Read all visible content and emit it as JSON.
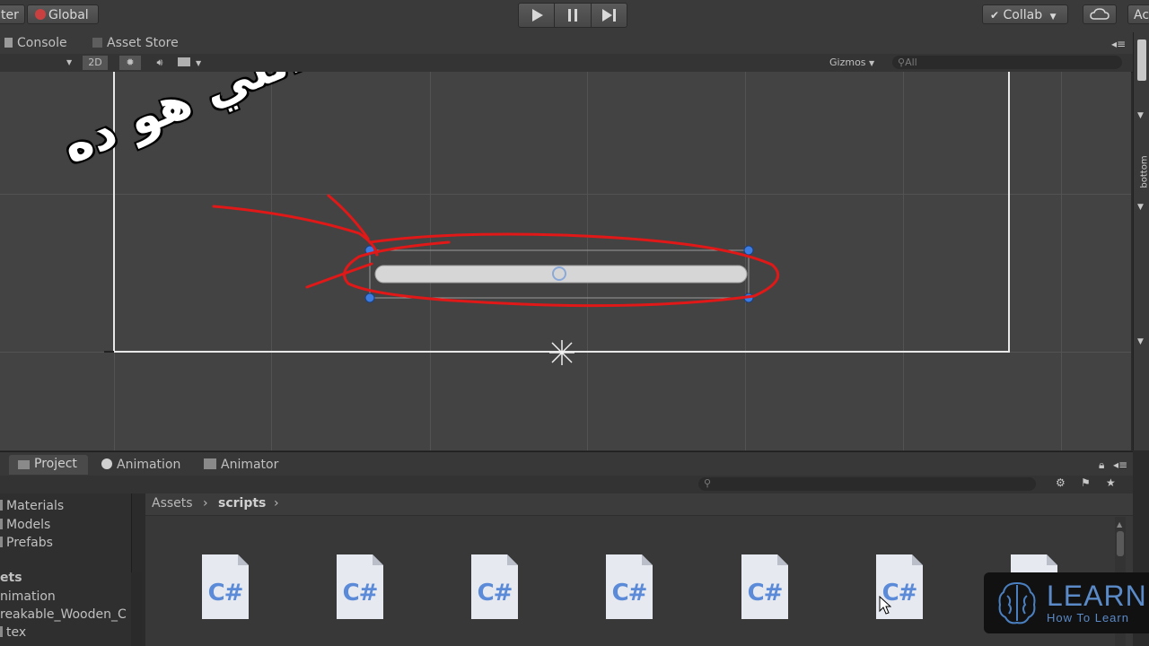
{
  "toolbar": {
    "pivot_label": "ter",
    "global_label": "Global",
    "collab_label": "Collab",
    "account_label": "Ac"
  },
  "scene_tabs": {
    "console": "Console",
    "asset_store": "Asset Store"
  },
  "scene_toolbar": {
    "mode_2d": "2D",
    "gizmos": "Gizmos",
    "search_placeholder": "All"
  },
  "annotation": {
    "arabic_text": "اللي هو ده",
    "color": "#e01818"
  },
  "right_strip": {
    "label": "bottom"
  },
  "project_tabs": {
    "project": "Project",
    "animation": "Animation",
    "animator": "Animator"
  },
  "breadcrumb": {
    "root": "Assets",
    "current": "scripts"
  },
  "tree": [
    "Materials",
    "Models",
    "Prefabs",
    "ets",
    "nimation",
    "reakable_Wooden_C",
    "tex"
  ],
  "files": {
    "icon_label": "C#",
    "count": 7
  },
  "logo": {
    "title": "LEARN",
    "subtitle": "How To Learn"
  },
  "colors": {
    "scene_bg": "#434343",
    "selection_handles": "#3c7be0",
    "annotation": "#e01818"
  }
}
